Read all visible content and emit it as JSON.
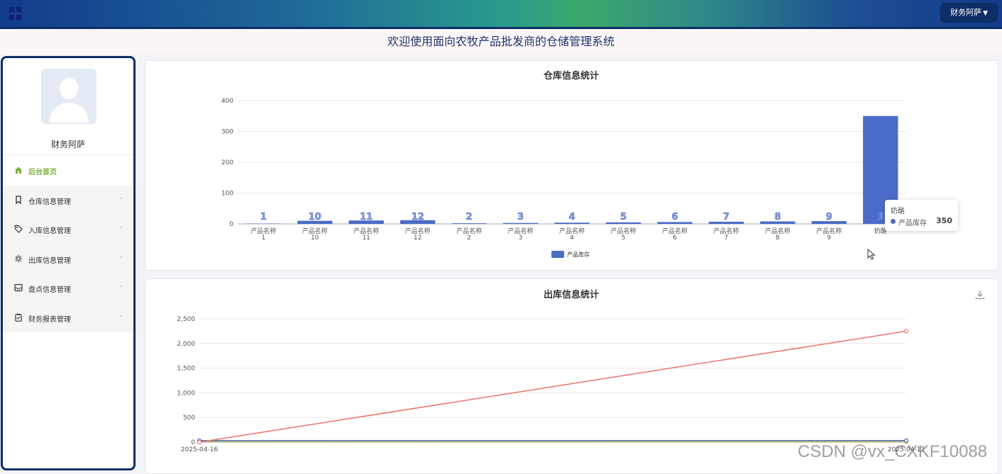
{
  "header": {
    "user_menu_label": "财务阿萨",
    "welcome_text": "欢迎使用面向农牧产品批发商的仓储管理系统"
  },
  "sidebar": {
    "username": "财务阿萨",
    "items": [
      {
        "label": "后台首页",
        "icon": "home-icon",
        "active": true
      },
      {
        "label": "仓库信息管理",
        "icon": "bookmark-icon"
      },
      {
        "label": "入库信息管理",
        "icon": "tag-icon"
      },
      {
        "label": "出库信息管理",
        "icon": "sun-icon"
      },
      {
        "label": "盘点信息管理",
        "icon": "inbox-icon"
      },
      {
        "label": "财务报表管理",
        "icon": "clipboard-icon"
      }
    ]
  },
  "tooltip": {
    "title": "奶酪",
    "series": "产品库存",
    "value": "350"
  },
  "watermark": "CSDN @vx_CXKF10088",
  "colors": {
    "accent": "#0d2e66",
    "bar": "#4a6bc7",
    "line_red": "#e8756b",
    "active_menu": "#7cb342"
  },
  "chart_data": [
    {
      "type": "bar",
      "title": "仓库信息统计",
      "categories": [
        "产品名称\n1",
        "产品名称\n10",
        "产品名称\n11",
        "产品名称\n12",
        "产品名称\n2",
        "产品名称\n3",
        "产品名称\n4",
        "产品名称\n5",
        "产品名称\n6",
        "产品名称\n7",
        "产品名称\n8",
        "产品名称\n9",
        "奶酪"
      ],
      "bar_labels": [
        "1",
        "10",
        "11",
        "12",
        "2",
        "3",
        "4",
        "5",
        "6",
        "7",
        "8",
        "9",
        "3"
      ],
      "series": [
        {
          "name": "产品库存",
          "values": [
            1,
            10,
            11,
            12,
            2,
            3,
            4,
            5,
            6,
            7,
            8,
            9,
            350
          ]
        }
      ],
      "ylim": [
        0,
        400
      ],
      "yticks": [
        0,
        100,
        200,
        300,
        400
      ],
      "legend": "bottom-center",
      "grid": true
    },
    {
      "type": "line",
      "title": "出库信息统计",
      "x": [
        "2025-04-16",
        "2025-04-17"
      ],
      "series": [
        {
          "values": [
            0,
            2250
          ],
          "color": "#e8756b"
        },
        {
          "values": [
            30,
            30
          ],
          "color": "#4a6bc7"
        },
        {
          "values": [
            20,
            15
          ],
          "color": "#e0b84a"
        },
        {
          "values": [
            10,
            10
          ],
          "color": "#91cc75"
        }
      ],
      "ylim": [
        0,
        2500
      ],
      "yticks": [
        "0",
        "500",
        "1,000",
        "1,500",
        "2,000",
        "2,500"
      ],
      "grid": true
    }
  ]
}
